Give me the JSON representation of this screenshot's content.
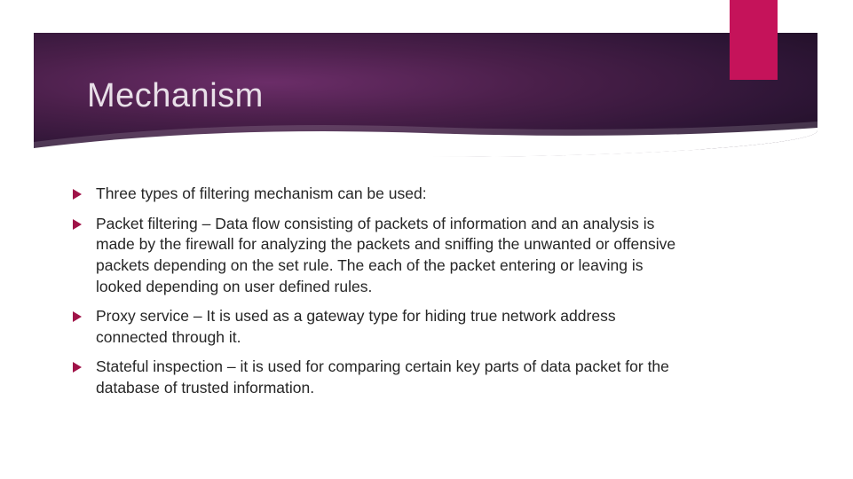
{
  "colors": {
    "accent": "#c5135a",
    "bullet": "#a01348",
    "titleText": "#e8dfe8",
    "bodyText": "#262626"
  },
  "slide": {
    "title": "Mechanism",
    "bullets": [
      "Three types of filtering mechanism can be used:",
      "Packet filtering – Data flow consisting of packets of information and an analysis is made by the firewall for analyzing the packets and sniffing the unwanted or offensive packets depending on the set rule. The each of the packet entering or leaving is looked depending on user defined rules.",
      "Proxy service – It is used as a gateway type for hiding true network address connected through it.",
      "Stateful inspection – it is used for comparing certain key parts of  data packet for the database of trusted information."
    ]
  }
}
